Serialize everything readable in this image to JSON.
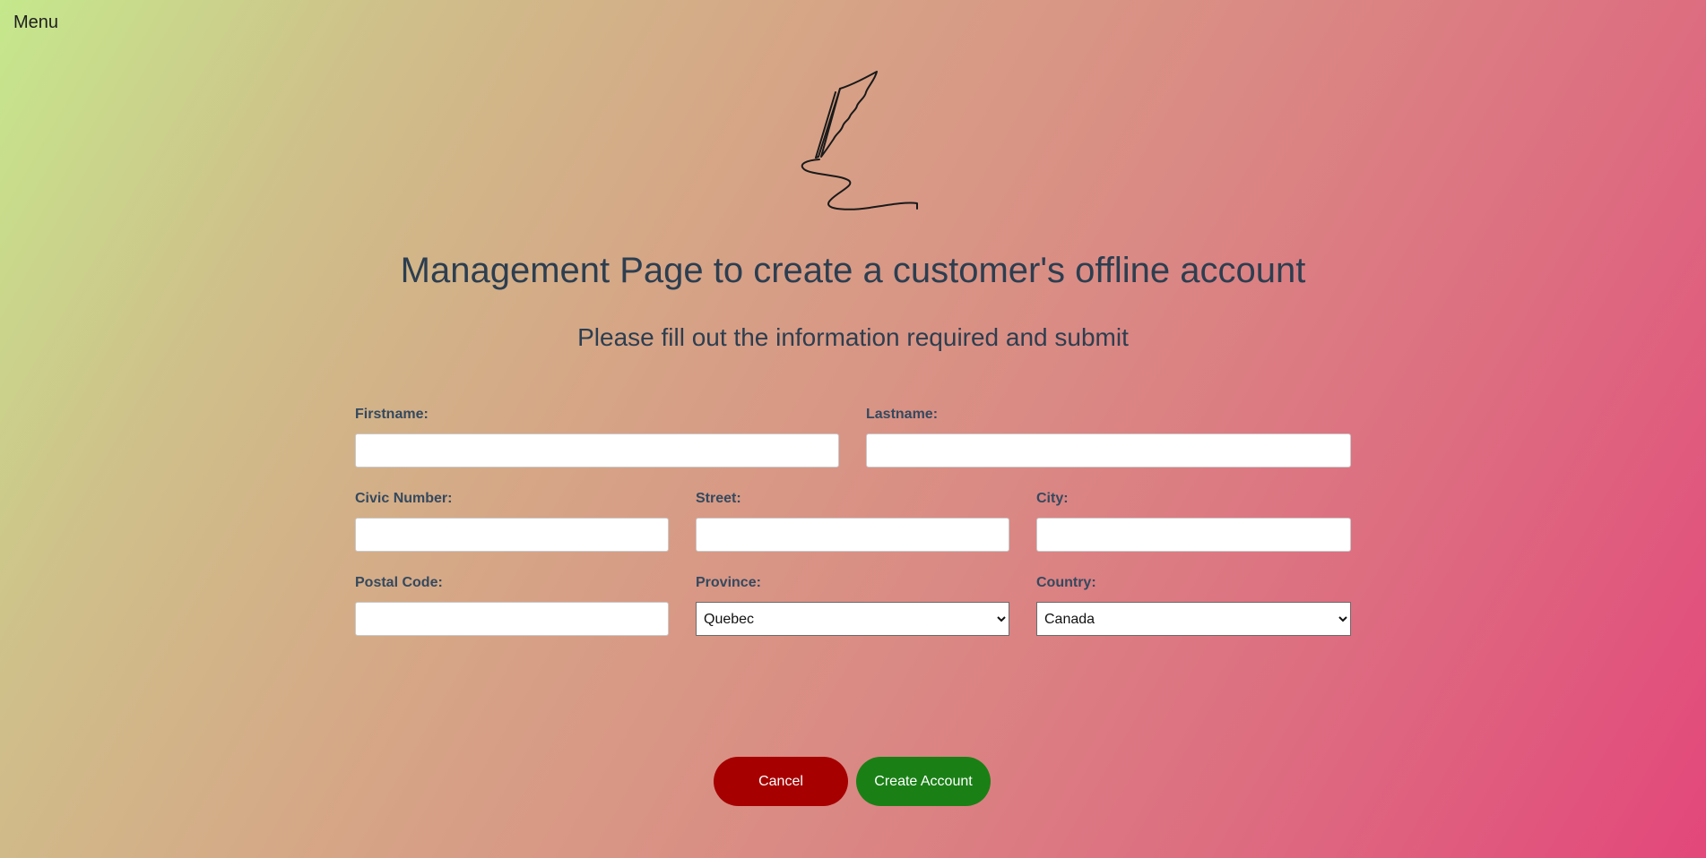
{
  "menu_label": "Menu",
  "logo": {
    "icon": "quill-signature-icon"
  },
  "title": "Management Page to create a customer's offline account",
  "subtitle": "Please fill out the information required and submit",
  "form": {
    "firstname": {
      "label": "Firstname:",
      "value": ""
    },
    "lastname": {
      "label": "Lastname:",
      "value": ""
    },
    "civic_number": {
      "label": "Civic Number:",
      "value": ""
    },
    "street": {
      "label": "Street:",
      "value": ""
    },
    "city": {
      "label": "City:",
      "value": ""
    },
    "postal_code": {
      "label": "Postal Code:",
      "value": ""
    },
    "province": {
      "label": "Province:",
      "selected": "Quebec"
    },
    "country": {
      "label": "Country:",
      "selected": "Canada"
    }
  },
  "buttons": {
    "cancel": "Cancel",
    "create": "Create Account"
  },
  "colors": {
    "cancel_button": "#a60000",
    "create_button": "#1a8016",
    "heading_text": "#2c3e50"
  }
}
